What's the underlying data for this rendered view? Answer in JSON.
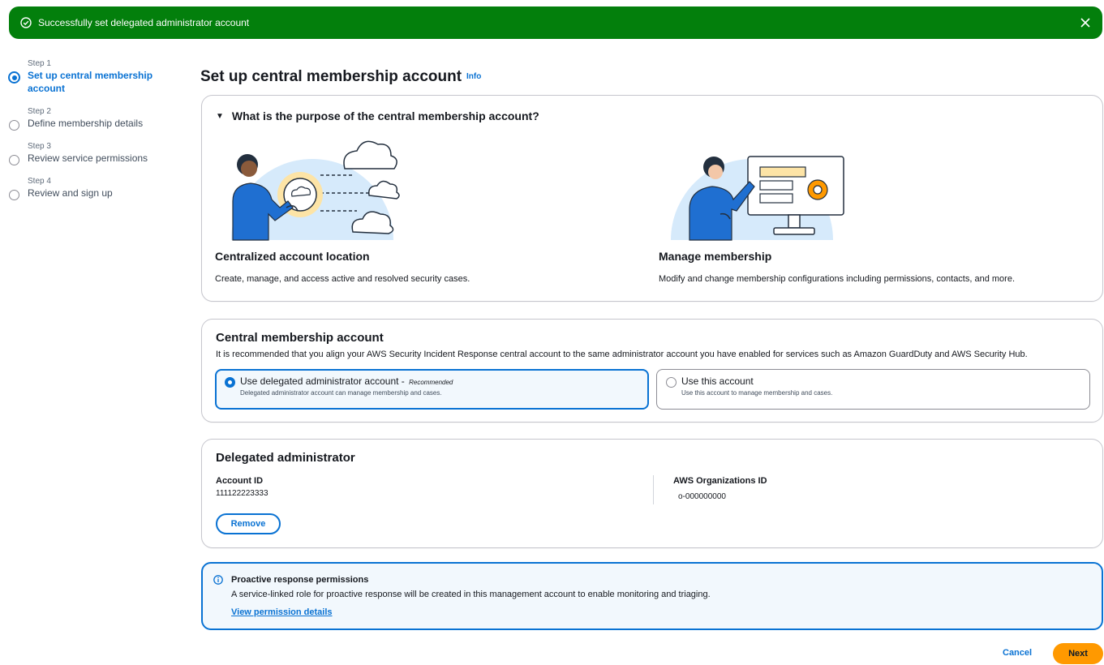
{
  "flash": {
    "message": "Successfully set delegated administrator account",
    "icon": "check-circle-icon",
    "color": "#037f0c"
  },
  "steps": [
    {
      "number": "Step 1",
      "label": "Set up central membership account",
      "active": true
    },
    {
      "number": "Step 2",
      "label": "Define membership details",
      "active": false
    },
    {
      "number": "Step 3",
      "label": "Review service permissions",
      "active": false
    },
    {
      "number": "Step 4",
      "label": "Review and sign up",
      "active": false
    }
  ],
  "page": {
    "title": "Set up central membership account",
    "info": "Info"
  },
  "purpose": {
    "header": "What is the purpose of the central membership account?",
    "features": [
      {
        "title": "Centralized account location",
        "desc": "Create, manage, and access active and resolved security cases."
      },
      {
        "title": "Manage membership",
        "desc": "Modify and change membership configurations including permissions, contacts, and more."
      }
    ]
  },
  "central": {
    "title": "Central membership account",
    "desc": "It is recommended that you align your AWS Security Incident Response central account to the same administrator account you have enabled for services such as Amazon GuardDuty and AWS Security Hub.",
    "options": [
      {
        "label": "Use delegated administrator account -",
        "recommended": "Recommended",
        "desc": "Delegated administrator account can manage membership and cases.",
        "selected": true
      },
      {
        "label": "Use this account",
        "recommended": "",
        "desc": "Use this account to manage membership and cases.",
        "selected": false
      }
    ]
  },
  "delegated": {
    "title": "Delegated administrator",
    "account_id_label": "Account ID",
    "account_id": "111122223333",
    "org_id_label": "AWS Organizations ID",
    "org_id": "o-000000000",
    "remove": "Remove"
  },
  "alert": {
    "title": "Proactive response permissions",
    "desc": "A service-linked role for proactive response will be created in this management account to enable monitoring and triaging.",
    "link": "View permission details"
  },
  "footer": {
    "cancel": "Cancel",
    "next": "Next"
  },
  "colors": {
    "accent": "#0972d3",
    "primary_button": "#ff9900",
    "success": "#037f0c"
  }
}
